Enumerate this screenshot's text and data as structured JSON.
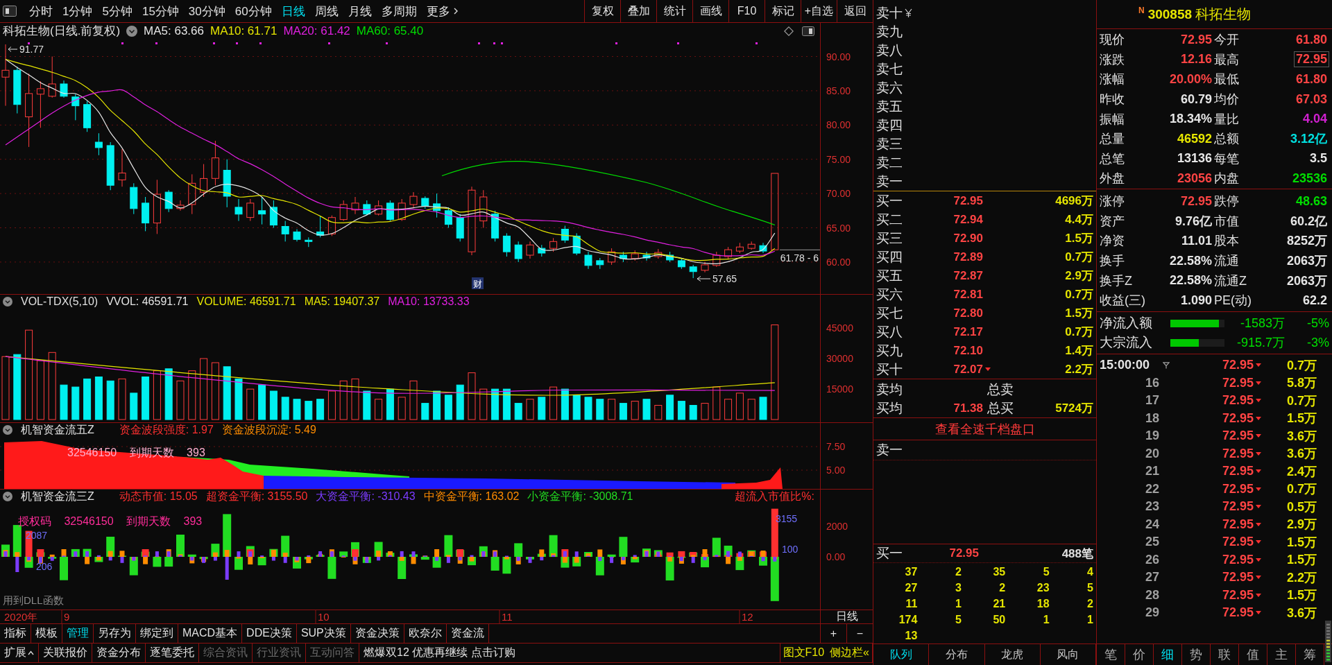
{
  "toolbar": {
    "periods": [
      {
        "label": "分时",
        "kind": "period",
        "selected": false
      },
      {
        "label": "1分钟",
        "kind": "period",
        "selected": false
      },
      {
        "label": "5分钟",
        "kind": "period",
        "selected": false
      },
      {
        "label": "15分钟",
        "kind": "period",
        "selected": false
      },
      {
        "label": "30分钟",
        "kind": "period",
        "selected": false
      },
      {
        "label": "60分钟",
        "kind": "period",
        "selected": false
      },
      {
        "label": "日线",
        "kind": "period",
        "selected": true
      },
      {
        "label": "周线",
        "kind": "period",
        "selected": false
      },
      {
        "label": "月线",
        "kind": "period",
        "selected": false
      },
      {
        "label": "多周期",
        "kind": "period",
        "selected": false
      },
      {
        "label": "更多",
        "kind": "menu",
        "selected": false
      }
    ],
    "buttons": [
      "复权",
      "叠加",
      "统计",
      "画线",
      "F10",
      "标记",
      "+自选",
      "返回"
    ]
  },
  "main_chart": {
    "title": "科拓生物(日线.前复权)",
    "ma": [
      {
        "label": "MA5: 63.66",
        "color": "#e6e6e6"
      },
      {
        "label": "MA10: 61.71",
        "color": "#e6e600"
      },
      {
        "label": "MA20: 61.42",
        "color": "#e020e0"
      },
      {
        "label": "MA60: 65.40",
        "color": "#00dd00"
      }
    ],
    "y_labels": [
      "90.00",
      "85.00",
      "80.00",
      "75.00",
      "70.00",
      "65.00",
      "60.00"
    ],
    "high_label": "91.77",
    "low_label": "57.65",
    "last_label": "61.78 - 6",
    "event_label": "财"
  },
  "volume_panel": {
    "title": "VOL-TDX(5,10)",
    "items": [
      {
        "label": "VVOL: 46591.71",
        "color": "#e6e6e6"
      },
      {
        "label": "VOLUME: 46591.71",
        "color": "#e6e600"
      },
      {
        "label": "MA5: 19407.37",
        "color": "#e6e600"
      },
      {
        "label": "MA10: 13733.33",
        "color": "#e020e0"
      }
    ],
    "y_labels": [
      "45000",
      "30000",
      "15000"
    ]
  },
  "flow5_panel": {
    "title": "机智资金流五Z",
    "items": [
      {
        "label": "资金波段强度: 1.97",
        "color": "#ff3030"
      },
      {
        "label": "资金波段沉淀: 5.49",
        "color": "#ff8c00"
      }
    ],
    "overlay": "32546150 到期天数 393",
    "y_labels": [
      "7.50",
      "5.00"
    ]
  },
  "flow3_panel": {
    "title": "机智资金流三Z",
    "items": [
      {
        "label": "动态市值: 15.05",
        "color": "#ff3030"
      },
      {
        "label": "超资金平衡: 3155.50",
        "color": "#ff3030"
      },
      {
        "label": "大资金平衡: -310.43",
        "color": "#7b3cff"
      },
      {
        "label": "中资金平衡: 163.02",
        "color": "#ff8c00"
      },
      {
        "label": "小资金平衡: -3008.71",
        "color": "#22dd22"
      }
    ],
    "right_label": "超流入市值比%:",
    "license": "授权码 32546150 到期天数 393",
    "bar_labels": [
      "2087",
      "206",
      "3155",
      "100"
    ],
    "note": "用到DLL函数",
    "y_labels": [
      "2000",
      "0.00"
    ]
  },
  "date_axis": {
    "year": "2020年",
    "months": [
      "9",
      "10",
      "11",
      "12"
    ],
    "period": "日线"
  },
  "bottom_toolbar": {
    "tabs": [
      {
        "label": "指标",
        "selected": false
      },
      {
        "label": "模板",
        "selected": false
      },
      {
        "label": "管理",
        "selected": true
      },
      {
        "label": "另存为",
        "selected": false
      },
      {
        "label": "绑定到",
        "selected": false
      },
      {
        "label": "MACD基本",
        "selected": false
      },
      {
        "label": "DDE决策",
        "selected": false
      },
      {
        "label": "SUP决策",
        "selected": false
      },
      {
        "label": "资金决策",
        "selected": false
      },
      {
        "label": "欧奈尔",
        "selected": false
      },
      {
        "label": "资金流",
        "selected": false
      }
    ],
    "zoom_buttons": [
      "+",
      "−"
    ]
  },
  "bottom_links": {
    "items": [
      {
        "label": "扩展",
        "kind": "expander",
        "disabled": false
      },
      {
        "label": "关联报价",
        "kind": "link",
        "disabled": false
      },
      {
        "label": "资金分布",
        "kind": "link",
        "disabled": false
      },
      {
        "label": "逐笔委托",
        "kind": "link",
        "disabled": false
      },
      {
        "label": "综合资讯",
        "kind": "link",
        "disabled": true
      },
      {
        "label": "行业资讯",
        "kind": "link",
        "disabled": true
      },
      {
        "label": "互动问答",
        "kind": "link",
        "disabled": true
      }
    ],
    "promo": "燃爆双12 优惠再继续 点击订购",
    "side_links": [
      "图文F10",
      "侧边栏«"
    ]
  },
  "order_book": {
    "asks": [
      "卖十",
      "卖九",
      "卖八",
      "卖七",
      "卖六",
      "卖五",
      "卖四",
      "卖三",
      "卖二",
      "卖一"
    ],
    "bids": [
      {
        "label": "买一",
        "price": "72.95",
        "volume": "4696万",
        "marker": false
      },
      {
        "label": "买二",
        "price": "72.94",
        "volume": "4.4万",
        "marker": false
      },
      {
        "label": "买三",
        "price": "72.90",
        "volume": "1.5万",
        "marker": false
      },
      {
        "label": "买四",
        "price": "72.89",
        "volume": "0.7万",
        "marker": false
      },
      {
        "label": "买五",
        "price": "72.87",
        "volume": "2.9万",
        "marker": false
      },
      {
        "label": "买六",
        "price": "72.81",
        "volume": "0.7万",
        "marker": false
      },
      {
        "label": "买七",
        "price": "72.80",
        "volume": "1.5万",
        "marker": false
      },
      {
        "label": "买八",
        "price": "72.17",
        "volume": "0.7万",
        "marker": false
      },
      {
        "label": "买九",
        "price": "72.10",
        "volume": "1.4万",
        "marker": false
      },
      {
        "label": "买十",
        "price": "72.07",
        "volume": "2.2万",
        "marker": true
      }
    ],
    "summary": [
      {
        "avg_label": "卖均",
        "total_label": "总卖"
      },
      {
        "avg_label": "买均",
        "avg": "71.38",
        "total_label": "总买",
        "total": "5724万"
      }
    ],
    "depth_link": "查看全速千档盘口",
    "queue_ask": "卖一",
    "queue_bid": {
      "label": "买一",
      "price": "72.95",
      "count": "488笔"
    },
    "queue_rows": [
      [
        "37",
        "2",
        "35",
        "5",
        "4"
      ],
      [
        "27",
        "3",
        "2",
        "23",
        "5"
      ],
      [
        "11",
        "1",
        "21",
        "18",
        "2"
      ],
      [
        "174",
        "5",
        "50",
        "1",
        "1"
      ],
      [
        "13"
      ]
    ],
    "tabs": [
      {
        "label": "队列",
        "selected": true
      },
      {
        "label": "分布",
        "selected": false
      },
      {
        "label": "龙虎",
        "selected": false
      },
      {
        "label": "风向",
        "selected": false
      }
    ]
  },
  "quote": {
    "badge": "N",
    "code": "300858",
    "name": "科拓生物",
    "block1": [
      [
        {
          "label": "现价",
          "value": "72.95",
          "color": "#ff4444",
          "boxed": false
        },
        {
          "label": "今开",
          "value": "61.80",
          "color": "#ff4444",
          "boxed": false
        }
      ],
      [
        {
          "label": "涨跌",
          "value": "12.16",
          "color": "#ff4444",
          "boxed": false
        },
        {
          "label": "最高",
          "value": "72.95",
          "color": "#ff4444",
          "boxed": true
        }
      ],
      [
        {
          "label": "涨幅",
          "value": "20.00%",
          "color": "#ff4444",
          "boxed": false
        },
        {
          "label": "最低",
          "value": "61.80",
          "color": "#ff4444",
          "boxed": false
        }
      ],
      [
        {
          "label": "昨收",
          "value": "60.79",
          "color": "#e6e6e6",
          "boxed": false
        },
        {
          "label": "均价",
          "value": "67.03",
          "color": "#ff4444",
          "boxed": false
        }
      ],
      [
        {
          "label": "振幅",
          "value": "18.34%",
          "color": "#e6e6e6",
          "boxed": false
        },
        {
          "label": "量比",
          "value": "4.04",
          "color": "#d020d0",
          "boxed": false
        }
      ],
      [
        {
          "label": "总量",
          "value": "46592",
          "color": "#e6e600",
          "boxed": false
        },
        {
          "label": "总额",
          "value": "3.12亿",
          "color": "#00e0e0",
          "boxed": false
        }
      ],
      [
        {
          "label": "总笔",
          "value": "13136",
          "color": "#e6e6e6",
          "boxed": false
        },
        {
          "label": "每笔",
          "value": "3.5",
          "color": "#e6e6e6",
          "boxed": false
        }
      ],
      [
        {
          "label": "外盘",
          "value": "23056",
          "color": "#ff4444",
          "boxed": false
        },
        {
          "label": "内盘",
          "value": "23536",
          "color": "#00dd00",
          "boxed": false
        }
      ]
    ],
    "block2": [
      [
        {
          "label": "涨停",
          "value": "72.95",
          "color": "#ff4444",
          "boxed": false
        },
        {
          "label": "跌停",
          "value": "48.63",
          "color": "#00dd00",
          "boxed": false
        }
      ],
      [
        {
          "label": "资产",
          "value": "9.76亿",
          "color": "#e6e6e6",
          "boxed": false
        },
        {
          "label": "市值",
          "value": "60.2亿",
          "color": "#e6e6e6",
          "boxed": false
        }
      ],
      [
        {
          "label": "净资",
          "value": "11.01",
          "color": "#e6e6e6",
          "boxed": false
        },
        {
          "label": "股本",
          "value": "8252万",
          "color": "#e6e6e6",
          "boxed": false
        }
      ],
      [
        {
          "label": "换手",
          "value": "22.58%",
          "color": "#e6e6e6",
          "boxed": false
        },
        {
          "label": "流通",
          "value": "2063万",
          "color": "#e6e6e6",
          "boxed": false
        }
      ],
      [
        {
          "label": "换手Z",
          "value": "22.58%",
          "color": "#e6e6e6",
          "boxed": false
        },
        {
          "label": "流通Z",
          "value": "2063万",
          "color": "#e6e6e6",
          "boxed": false
        }
      ],
      [
        {
          "label": "收益(三)",
          "value": "1.090",
          "color": "#e6e6e6",
          "boxed": false
        },
        {
          "label": "PE(动)",
          "value": "62.2",
          "color": "#e6e6e6",
          "boxed": false
        }
      ]
    ],
    "flows": [
      {
        "label": "净流入额",
        "level": 0.9,
        "amount": "-1583万",
        "percent": "-5%"
      },
      {
        "label": "大宗流入",
        "level": 0.52,
        "amount": "-915.7万",
        "percent": "-3%"
      }
    ]
  },
  "ticks": {
    "rows": [
      {
        "time": "15:00:00",
        "price": "72.95",
        "falling": true,
        "volume": "0.7万"
      },
      {
        "time": "16",
        "price": "72.95",
        "falling": true,
        "volume": "5.8万"
      },
      {
        "time": "17",
        "price": "72.95",
        "falling": true,
        "volume": "0.7万"
      },
      {
        "time": "18",
        "price": "72.95",
        "falling": true,
        "volume": "1.5万"
      },
      {
        "time": "19",
        "price": "72.95",
        "falling": true,
        "volume": "3.6万"
      },
      {
        "time": "20",
        "price": "72.95",
        "falling": true,
        "volume": "3.6万"
      },
      {
        "time": "21",
        "price": "72.95",
        "falling": true,
        "volume": "2.4万"
      },
      {
        "time": "22",
        "price": "72.95",
        "falling": true,
        "volume": "0.7万"
      },
      {
        "time": "23",
        "price": "72.95",
        "falling": true,
        "volume": "0.5万"
      },
      {
        "time": "24",
        "price": "72.95",
        "falling": true,
        "volume": "2.9万"
      },
      {
        "time": "25",
        "price": "72.95",
        "falling": true,
        "volume": "1.5万"
      },
      {
        "time": "26",
        "price": "72.95",
        "falling": true,
        "volume": "1.5万"
      },
      {
        "time": "27",
        "price": "72.95",
        "falling": true,
        "volume": "2.2万"
      },
      {
        "time": "28",
        "price": "72.95",
        "falling": true,
        "volume": "1.5万"
      },
      {
        "time": "29",
        "price": "72.95",
        "falling": true,
        "volume": "3.6万"
      }
    ],
    "tabs": [
      {
        "label": "笔",
        "selected": false
      },
      {
        "label": "价",
        "selected": false
      },
      {
        "label": "细",
        "selected": true
      },
      {
        "label": "势",
        "selected": false
      },
      {
        "label": "联",
        "selected": false
      },
      {
        "label": "值",
        "selected": false
      },
      {
        "label": "主",
        "selected": false
      },
      {
        "label": "筹",
        "selected": false
      }
    ]
  }
}
